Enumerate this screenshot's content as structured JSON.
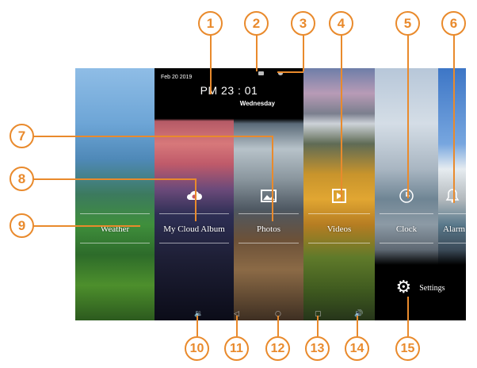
{
  "status": {
    "date": "Feb 20 2019",
    "time": "PM 23 : 01",
    "weekday": "Wednesday"
  },
  "tiles": [
    {
      "label": "Weather",
      "icon": "weather-icon"
    },
    {
      "label": "My Cloud Album",
      "icon": "cloud-icon"
    },
    {
      "label": "Photos",
      "icon": "photo-icon"
    },
    {
      "label": "Videos",
      "icon": "video-icon"
    },
    {
      "label": "Clock",
      "icon": "clock-icon"
    },
    {
      "label": "Alarm",
      "icon": "bell-icon"
    }
  ],
  "settings": {
    "label": "Settings",
    "icon": "gear-icon"
  },
  "nav": {
    "icons": [
      "volume-down-icon",
      "back-icon",
      "home-icon",
      "recent-icon",
      "volume-up-icon"
    ]
  },
  "callouts": [
    "1",
    "2",
    "3",
    "4",
    "5",
    "6",
    "7",
    "8",
    "9",
    "10",
    "11",
    "12",
    "13",
    "14",
    "15"
  ],
  "colors": {
    "callout": "#e98a2c",
    "screen_bg": "#000000",
    "label": "#ffffff"
  }
}
